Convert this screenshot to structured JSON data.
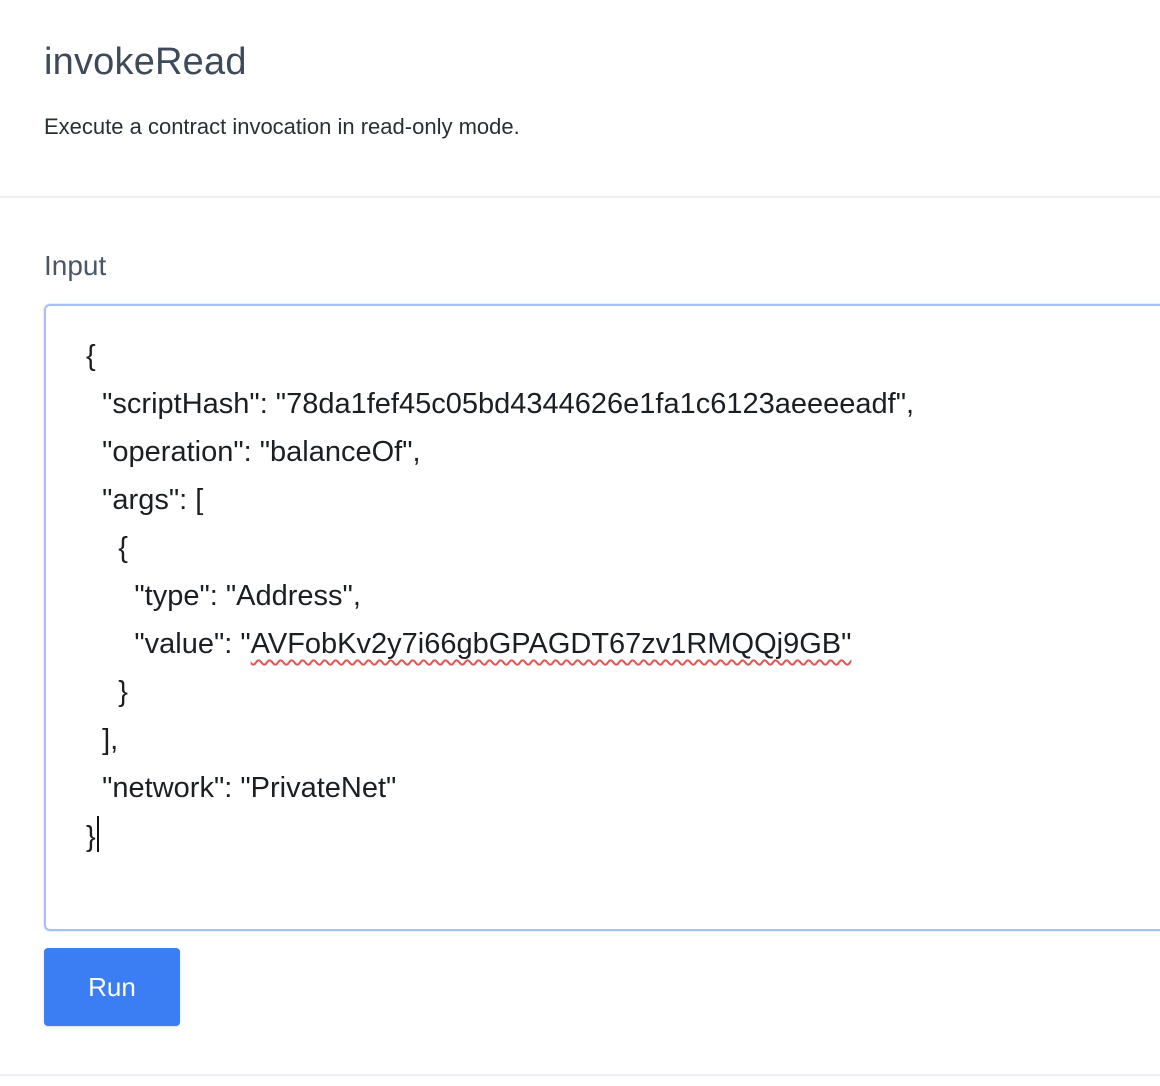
{
  "header": {
    "title": "invokeRead",
    "description": "Execute a contract invocation in read-only mode."
  },
  "input": {
    "label": "Input",
    "lines": [
      "{",
      "  \"scriptHash\": \"78da1fef45c05bd4344626e1fa1c6123aeeeeadf\",",
      "  \"operation\": \"balanceOf\",",
      "  \"args\": [",
      "    {",
      "      \"type\": \"Address\",",
      "      \"value\": \"",
      "    }",
      "  ],",
      "  \"network\": \"PrivateNet\"",
      "}"
    ],
    "value_misspelled": "AVFobKv2y7i66gbGPAGDT67zv1RMQQj9GB\""
  },
  "actions": {
    "run_label": "Run"
  },
  "colors": {
    "accent": "#3b7ef3",
    "editor_border": "#a8bff5",
    "spellcheck": "#e25555"
  }
}
